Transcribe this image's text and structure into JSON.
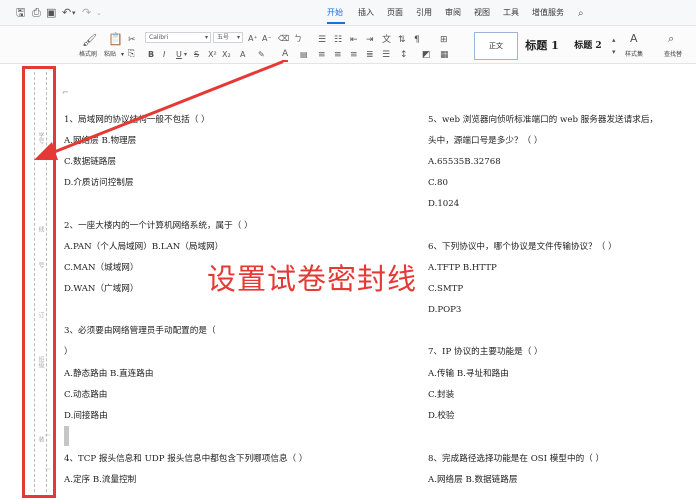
{
  "tabs": [
    "开始",
    "插入",
    "页面",
    "引用",
    "审阅",
    "视图",
    "工具",
    "增值服务"
  ],
  "ribbon": {
    "format_painter": "格式刷",
    "paste": "粘贴",
    "font_name": "Calibri",
    "font_size": "五号",
    "style_normal": "正文",
    "style_h1": "标题 1",
    "style_h2": "标题 2",
    "styles_set": "样式集",
    "find_replace": "查找替"
  },
  "gutter": {
    "label_1": "学号",
    "label_2": "线",
    "label_3": "号",
    "label_4": "订",
    "label_5": "班级",
    "label_6": "装"
  },
  "overlay_caption": "设置试卷密封线",
  "questions_left": [
    {
      "text": "1、局域网的协议结构一般不包括（  ）"
    },
    {
      "text": "A.网络层 B.物理层"
    },
    {
      "text": "C.数据链路层"
    },
    {
      "text": "D.介质访问控制层"
    },
    {
      "text": "2、一座大楼内的一个计算机网络系统，属于（  ）"
    },
    {
      "text": "A.PAN（个人局域网）B.LAN（局域网）"
    },
    {
      "text": "C.MAN（城域网）"
    },
    {
      "text": "D.WAN（广域网）"
    },
    {
      "text": "3、必须要由网络管理员手动配置的是（"
    },
    {
      "text": "）"
    },
    {
      "text": "A.静态路由 B.直连路由"
    },
    {
      "text": "C.动态路由"
    },
    {
      "text": "D.间接路由"
    },
    {
      "text": "4、TCP 报头信息和 UDP 报头信息中都包含下列哪项信息（  ）"
    },
    {
      "text": "A.定序 B.流量控制"
    }
  ],
  "questions_right": [
    {
      "text": "5、web 浏览器向侦听标准端口的 web 服务器发送请求后，"
    },
    {
      "text": "头中，源端口号是多少？（  ）"
    },
    {
      "text": "A.65535B.32768"
    },
    {
      "text": "C.80"
    },
    {
      "text": "D.1024"
    },
    {
      "text": "6、下列协议中，哪个协议是文件传输协议？（  ）"
    },
    {
      "text": "A.TFTP B.HTTP"
    },
    {
      "text": "C.SMTP"
    },
    {
      "text": "D.POP3"
    },
    {
      "text": "7、IP 协议的主要功能是（  ）"
    },
    {
      "text": "A.传输 B.寻址和路由"
    },
    {
      "text": "C.封装"
    },
    {
      "text": "D.校验"
    },
    {
      "text": "8、完成路径选择功能是在 OSI 模型中的（  ）"
    },
    {
      "text": "A.网络层 B.数据链路层"
    }
  ],
  "colors": {
    "accent": "#1d6fe0",
    "annotation": "#e53935"
  }
}
